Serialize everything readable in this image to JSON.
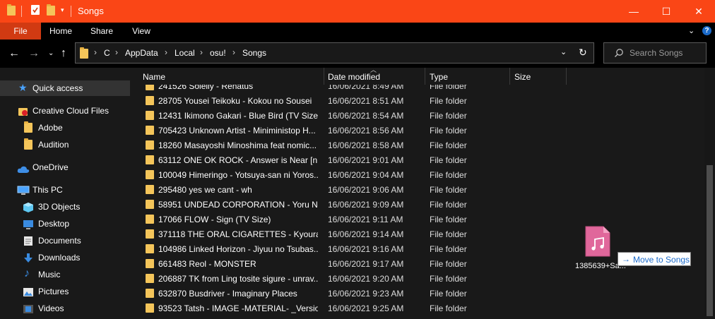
{
  "window": {
    "title": "Songs",
    "controls": {
      "minimize": "—",
      "maximize": "☐",
      "close": "✕"
    }
  },
  "ribbon": {
    "tabs": [
      "File",
      "Home",
      "Share",
      "View"
    ],
    "expand_icon": "chevron-down-icon",
    "help_icon": "help-icon"
  },
  "address": {
    "breadcrumbs": [
      "C",
      "AppData",
      "Local",
      "osu!",
      "Songs"
    ],
    "separator": "›"
  },
  "search": {
    "placeholder": "Search Songs"
  },
  "nav": {
    "items": [
      {
        "label": "Quick access",
        "icon": "star-icon"
      },
      {
        "label": "Creative Cloud Files",
        "icon": "creative-cloud-icon"
      },
      {
        "label": "Adobe",
        "icon": "folder-icon"
      },
      {
        "label": "Audition",
        "icon": "folder-icon"
      },
      {
        "label": "OneDrive",
        "icon": "cloud-icon"
      },
      {
        "label": "This PC",
        "icon": "computer-icon"
      },
      {
        "label": "3D Objects",
        "icon": "cube-icon"
      },
      {
        "label": "Desktop",
        "icon": "desktop-icon"
      },
      {
        "label": "Documents",
        "icon": "document-icon"
      },
      {
        "label": "Downloads",
        "icon": "download-icon"
      },
      {
        "label": "Music",
        "icon": "music-icon"
      },
      {
        "label": "Pictures",
        "icon": "picture-icon"
      },
      {
        "label": "Videos",
        "icon": "video-icon"
      }
    ]
  },
  "columns": {
    "name": "Name",
    "date": "Date modified",
    "type": "Type",
    "size": "Size"
  },
  "files": [
    {
      "name": "241526 Soleily - Renatus",
      "date": "16/06/2021 8:49 AM",
      "type": "File folder"
    },
    {
      "name": "28705 Yousei Teikoku - Kokou no Sousei",
      "date": "16/06/2021 8:51 AM",
      "type": "File folder"
    },
    {
      "name": "12431 Ikimono Gakari - Blue Bird (TV Size)",
      "date": "16/06/2021 8:54 AM",
      "type": "File folder"
    },
    {
      "name": "705423 Unknown Artist - Miniministop H...",
      "date": "16/06/2021 8:56 AM",
      "type": "File folder"
    },
    {
      "name": "18260 Masayoshi Minoshima feat nomic...",
      "date": "16/06/2021 8:58 AM",
      "type": "File folder"
    },
    {
      "name": "63112 ONE OK ROCK - Answer is Near [n...",
      "date": "16/06/2021 9:01 AM",
      "type": "File folder"
    },
    {
      "name": "100049 Himeringo - Yotsuya-san ni Yoros...",
      "date": "16/06/2021 9:04 AM",
      "type": "File folder"
    },
    {
      "name": "295480 yes we cant - wh",
      "date": "16/06/2021 9:06 AM",
      "type": "File folder"
    },
    {
      "name": "58951 UNDEAD CORPORATION - Yoru Na...",
      "date": "16/06/2021 9:09 AM",
      "type": "File folder"
    },
    {
      "name": "17066 FLOW - Sign (TV Size)",
      "date": "16/06/2021 9:11 AM",
      "type": "File folder"
    },
    {
      "name": "371118 THE ORAL CIGARETTES - Kyouran ...",
      "date": "16/06/2021 9:14 AM",
      "type": "File folder"
    },
    {
      "name": "104986 Linked Horizon - Jiyuu no Tsubas...",
      "date": "16/06/2021 9:16 AM",
      "type": "File folder"
    },
    {
      "name": "661483 Reol - MONSTER",
      "date": "16/06/2021 9:17 AM",
      "type": "File folder"
    },
    {
      "name": "206887 TK from Ling tosite sigure - unrav...",
      "date": "16/06/2021 9:20 AM",
      "type": "File folder"
    },
    {
      "name": "632870 Busdriver - Imaginary Places",
      "date": "16/06/2021 9:23 AM",
      "type": "File folder"
    },
    {
      "name": "93523 Tatsh - IMAGE -MATERIAL- _Versio...",
      "date": "16/06/2021 9:25 AM",
      "type": "File folder"
    }
  ],
  "drag": {
    "file_label": "1385639+Sa...",
    "tooltip": "Move to Songs",
    "tooltip_arrow": "→",
    "file_icon": "audio-file-icon"
  },
  "colors": {
    "titlebar": "#FA4616",
    "file_tab": "#D13A12",
    "folder": "#F4C55A",
    "audio_file": "#E0679B",
    "tooltip_text": "#1b6ac9"
  }
}
